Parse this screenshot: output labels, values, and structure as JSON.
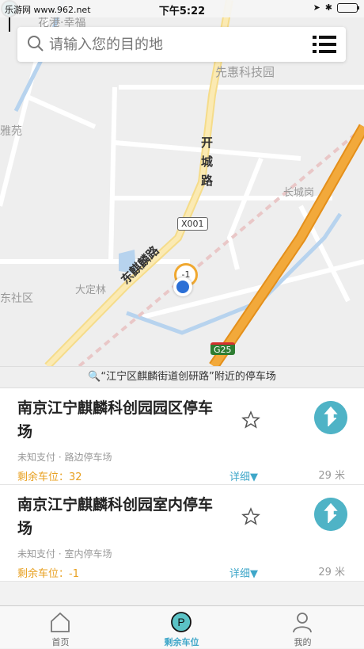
{
  "status_bar": {
    "carrier": "乐游网 www.962.net",
    "time": "下午5:22"
  },
  "map": {
    "labels": [
      "花港·幸福",
      "先惠科技园",
      "雅苑",
      "长城岗",
      "大定林",
      "东社区"
    ],
    "road_labels": [
      "开城路",
      "东麒麟路"
    ],
    "shields": [
      "X001",
      "G25"
    ],
    "location_badge": "-1",
    "colors": {
      "highway": "#f2a93b",
      "road_yellow": "#f5dc8a",
      "water": "#b7d3ee",
      "rail": "#e3b7b7"
    }
  },
  "search": {
    "placeholder": "请输入您的目的地"
  },
  "nearby": {
    "text": "“江宁区麒麟街道创研路”附近的停车场"
  },
  "parking_list": [
    {
      "name": "南京江宁麒麟科创园园区停车场",
      "meta": "未知支付 · 路边停车场",
      "remaining": "剩余车位：32",
      "detail": "详细▼",
      "distance": "29 米"
    },
    {
      "name": "南京江宁麒麟科创园室内停车场",
      "meta": "未知支付 · 室内停车场",
      "remaining": "剩余车位：-1",
      "detail": "详细▼",
      "distance": "29 米"
    }
  ],
  "tabs": [
    {
      "label": "首页",
      "icon": "home-icon"
    },
    {
      "label": "剩余车位",
      "icon": "parking-icon"
    },
    {
      "label": "我的",
      "icon": "user-icon"
    }
  ],
  "accent_color": "#3fa7c9"
}
